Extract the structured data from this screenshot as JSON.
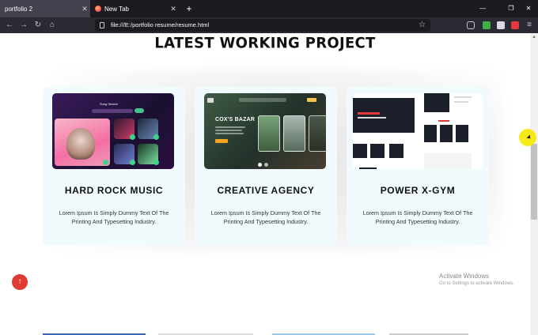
{
  "browser": {
    "tabs": [
      {
        "title": "portfolio 2",
        "active": true
      },
      {
        "title": "New Tab",
        "active": false
      }
    ],
    "url": "file:///E:/portfolio resume/resume.html"
  },
  "section": {
    "title": "LATEST WORKING PROJECT"
  },
  "projects": [
    {
      "title": "HARD ROCK MUSIC",
      "description": "Lorem Ipsum Is Simply Dummy Text Of The Printing And Typesetting Industry.",
      "thumb_text": "Song Search"
    },
    {
      "title": "CREATIVE AGENCY",
      "description": "Lorem Ipsum Is Simply Dummy Text Of The Printing And Typesetting Industry.",
      "thumb_text": "COX'S BAZAR"
    },
    {
      "title": "POWER X-GYM",
      "description": "Lorem Ipsum Is Simply Dummy Text Of The Printing And Typesetting Industry.",
      "thumb_text": ""
    }
  ],
  "watermark": {
    "title": "Activate Windows",
    "subtitle": "Go to Settings to activate Windows."
  },
  "icons": {
    "back": "arrow-left-icon",
    "forward": "arrow-right-icon",
    "reload": "reload-icon",
    "home": "home-icon",
    "bookmark": "star-icon",
    "scroll_top": "arrow-up-icon"
  },
  "colors": {
    "accent_red": "#e03a32",
    "card_bg": "#f1fbfd",
    "chrome_dark": "#1c1b22"
  }
}
